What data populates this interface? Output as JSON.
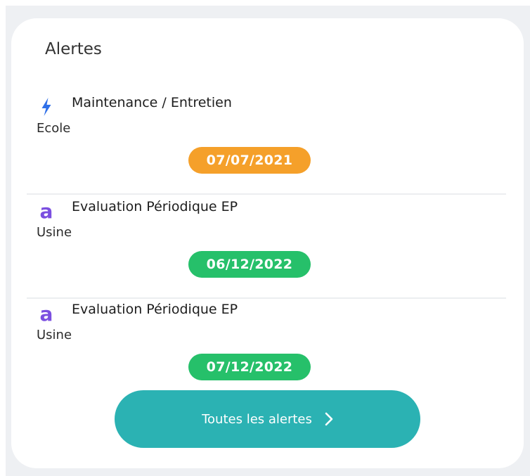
{
  "card": {
    "title": "Alertes"
  },
  "alerts": [
    {
      "icon": "lightning-icon",
      "icon_color": "#2f6fe8",
      "title": "Maintenance / Entretien",
      "subtitle": "Ecole",
      "date": "07/07/2021",
      "badge_color": "#f5a02a"
    },
    {
      "icon": "letter-a-icon",
      "icon_glyph": "a",
      "icon_color": "#7b4fe0",
      "title": "Evaluation Périodique EP",
      "subtitle": "Usine",
      "date": "06/12/2022",
      "badge_color": "#26c06a"
    },
    {
      "icon": "letter-a-icon",
      "icon_glyph": "a",
      "icon_color": "#7b4fe0",
      "title": "Evaluation Périodique EP",
      "subtitle": "Usine",
      "date": "07/12/2022",
      "badge_color": "#26c06a"
    }
  ],
  "cta": {
    "label": "Toutes les alertes",
    "icon": "chevron-right-icon",
    "color": "#2bb2b3"
  }
}
